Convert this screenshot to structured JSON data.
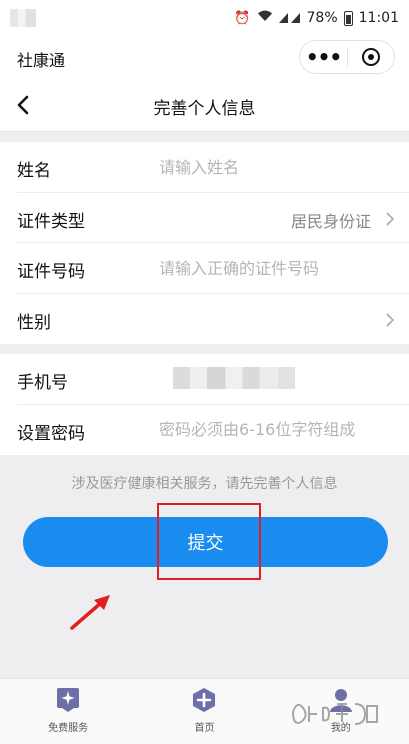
{
  "status_bar": {
    "battery": "78%",
    "time": "11:01",
    "icons": [
      "alarm-icon",
      "wifi-icon",
      "signal-icon",
      "battery-icon"
    ]
  },
  "app_bar": {
    "app_name": "社康通",
    "more_glyph": "•••"
  },
  "nav": {
    "title": "完善个人信息"
  },
  "form": {
    "name": {
      "label": "姓名",
      "placeholder": "请输入姓名"
    },
    "id_type": {
      "label": "证件类型",
      "value": "居民身份证"
    },
    "id_number": {
      "label": "证件号码",
      "placeholder": "请输入正确的证件号码"
    },
    "gender": {
      "label": "性别"
    },
    "phone": {
      "label": "手机号"
    },
    "password": {
      "label": "设置密码",
      "placeholder": "密码必须由6-16位字符组成"
    }
  },
  "hint": "涉及医疗健康相关服务，请先完善个人信息",
  "submit_label": "提交",
  "tabs": [
    {
      "label": "免费服务",
      "icon": "star-badge-icon"
    },
    {
      "label": "首页",
      "icon": "plus-hexagon-icon"
    },
    {
      "label": "我的",
      "icon": "person-icon"
    }
  ],
  "colors": {
    "accent": "#1a8cf0",
    "highlight": "#e31e1e",
    "tab_icon": "#6e6ea8"
  }
}
